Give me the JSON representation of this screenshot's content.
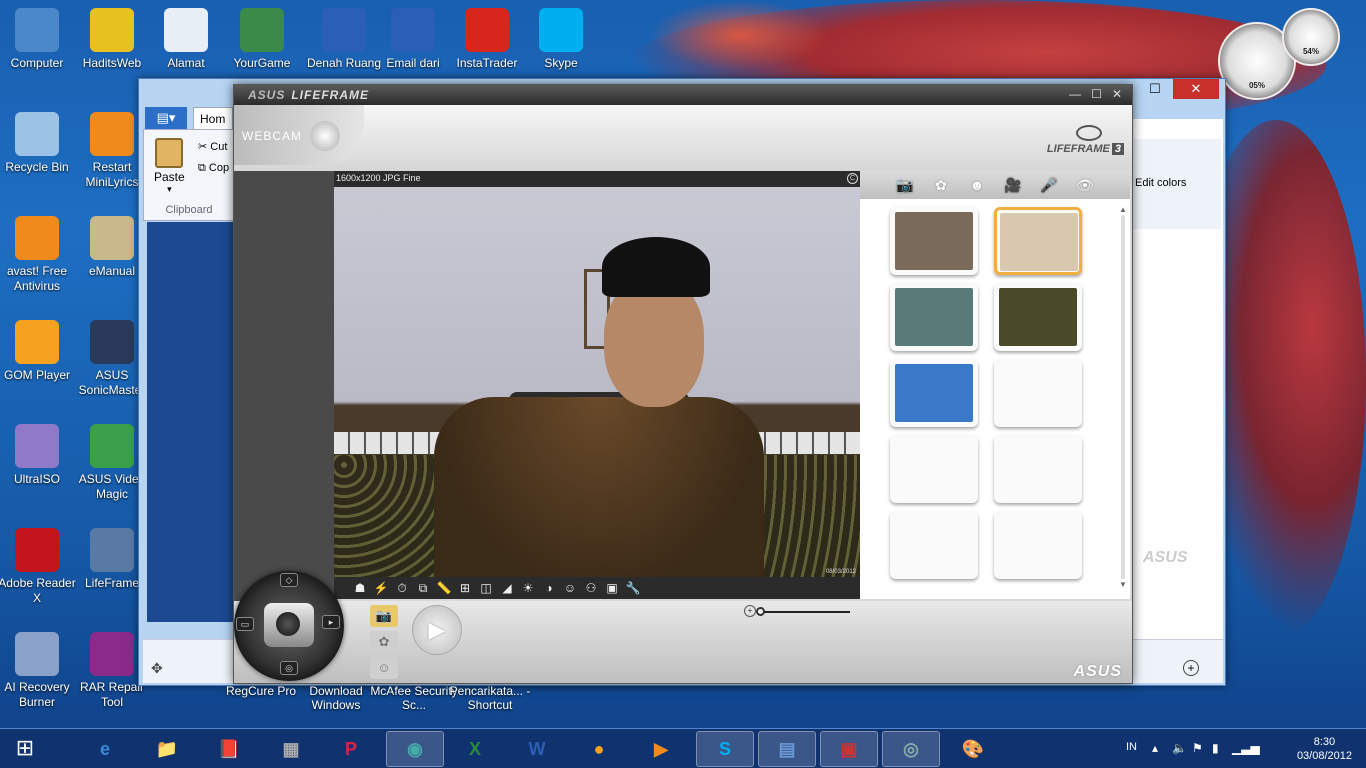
{
  "desktop": {
    "icons_row1": [
      {
        "label": "Computer",
        "icon": "computer-icon",
        "color": "#4a88c9"
      },
      {
        "label": "HaditsWeb",
        "icon": "help-document-icon",
        "color": "#e6c120"
      },
      {
        "label": "Alamat",
        "icon": "text-file-icon",
        "color": "#e8eef6"
      },
      {
        "label": "YourGame",
        "icon": "window-app-icon",
        "color": "#3a8a4a"
      },
      {
        "label": "Denah Ruang",
        "icon": "word-document-icon",
        "color": "#2b5fb5"
      },
      {
        "label": "Email dari",
        "icon": "word-document-icon",
        "color": "#2b5fb5"
      },
      {
        "label": "InstaTrader",
        "icon": "instatrader-icon",
        "color": "#d9261c"
      },
      {
        "label": "Skype",
        "icon": "skype-icon",
        "color": "#00aff0"
      }
    ],
    "icons_col1": [
      {
        "label": "Recycle Bin",
        "icon": "recycle-bin-icon",
        "color": "#9cc3e6"
      },
      {
        "label": "avast! Free Antivirus",
        "icon": "avast-icon",
        "color": "#f08a1c"
      },
      {
        "label": "GOM Player",
        "icon": "gom-player-icon",
        "color": "#f5a21e"
      },
      {
        "label": "UltraISO",
        "icon": "disc-icon",
        "color": "#8e7ac9"
      },
      {
        "label": "Adobe Reader X",
        "icon": "adobe-reader-icon",
        "color": "#c4151c"
      },
      {
        "label": "AI Recovery Burner",
        "icon": "disc-burner-icon",
        "color": "#8aa2c9"
      }
    ],
    "icons_col2": [
      {
        "label": "Restart MiniLyrics",
        "icon": "music-note-icon",
        "color": "#f08a1c"
      },
      {
        "label": "eManual",
        "icon": "manual-icon",
        "color": "#c9b98a"
      },
      {
        "label": "ASUS SonicMaster",
        "icon": "sonicmaster-icon",
        "color": "#2a3a5a"
      },
      {
        "label": "ASUS Video Magic",
        "icon": "video-magic-icon",
        "color": "#3aa04a"
      },
      {
        "label": "LifeFrame",
        "icon": "lifeframe-icon",
        "color": "#5a7aa6"
      },
      {
        "label": "RAR Repair Tool",
        "icon": "rar-icon",
        "color": "#8a2a8a"
      }
    ],
    "icons_col3": [
      {
        "label": "ASUS SonicMaster",
        "icon": "sonicmaster-icon",
        "color": "#2a3a5a"
      },
      {
        "label": "ASUS Video Magic",
        "icon": "video-magic-icon",
        "color": "#3aa04a"
      },
      {
        "label": "LifeFrame",
        "icon": "lifeframe-icon",
        "color": "#5a7aa6"
      },
      {
        "label": "RAR Repair Tool",
        "icon": "rar-icon",
        "color": "#8a2a8a"
      }
    ],
    "partial_labels": [
      "RegCure Pro",
      "Download Windows",
      "McAfee Security Sc...",
      "Pencarikata... - Shortcut"
    ],
    "gadget": {
      "cpu": "05%",
      "ram": "54%"
    }
  },
  "explorer": {
    "ribbon": {
      "home_tab": "Hom",
      "paste": "Paste",
      "cut": "Cut",
      "copy": "Cop",
      "group": "Clipboard"
    },
    "edit_colors": "Edit colors",
    "watermark": "ASUS"
  },
  "lifeframe": {
    "brand": "ASUS",
    "title": "LIFEFRAME",
    "webcam_label": "WEBCAM",
    "logo": "LIFEFRAME",
    "logo_version": "3",
    "resolution": "1600x1200 JPG Fine",
    "preview_watermark": "08/03/2012",
    "tabs": [
      {
        "name": "camera-tab",
        "icon": "📷"
      },
      {
        "name": "effects-tab",
        "icon": "✿"
      },
      {
        "name": "face-tab",
        "icon": "☻"
      },
      {
        "name": "video-tab",
        "icon": "🎥"
      },
      {
        "name": "mic-tab",
        "icon": "🎤"
      },
      {
        "name": "view-tab",
        "icon": "👁"
      }
    ],
    "thumbnails": [
      {
        "color": "#7a6a5a",
        "selected": false
      },
      {
        "color": "#d8c8b0",
        "selected": true
      },
      {
        "color": "#5a7a7a",
        "selected": false
      },
      {
        "color": "#4a4a2a",
        "selected": false
      },
      {
        "color": "#3a78c8",
        "selected": false
      },
      {
        "color": "#fafafa",
        "selected": false
      },
      {
        "color": "#fafafa",
        "selected": false
      },
      {
        "color": "#fafafa",
        "selected": false
      },
      {
        "color": "#fafafa",
        "selected": false
      },
      {
        "color": "#fafafa",
        "selected": false
      }
    ],
    "toolbar": [
      "☗",
      "⚡",
      "⏱",
      "⧉",
      "📏",
      "⊞",
      "◫",
      "◢",
      "☀",
      "◑",
      "☺",
      "⚇",
      "▣",
      "🔧"
    ],
    "zoom_level": 0,
    "asus_footer": "ASUS"
  },
  "taskbar": {
    "apps": [
      {
        "name": "internet-explorer",
        "icon": "e",
        "color": "#3a8ad6",
        "open": false
      },
      {
        "name": "file-explorer",
        "icon": "📁",
        "color": "#e6c060",
        "open": false
      },
      {
        "name": "book-app",
        "icon": "📕",
        "color": "#c33",
        "open": false
      },
      {
        "name": "calculator",
        "icon": "▦",
        "color": "#aaa",
        "open": false
      },
      {
        "name": "powerpoint",
        "icon": "P",
        "color": "#d24",
        "open": false
      },
      {
        "name": "network-app",
        "icon": "◉",
        "color": "#4aa",
        "open": true
      },
      {
        "name": "excel",
        "icon": "X",
        "color": "#2a8a3a",
        "open": false
      },
      {
        "name": "word",
        "icon": "W",
        "color": "#2b5fb5",
        "open": false
      },
      {
        "name": "gom-player",
        "icon": "●",
        "color": "#f5a21e",
        "open": false
      },
      {
        "name": "media-player",
        "icon": "▶",
        "color": "#f08a1c",
        "open": false
      },
      {
        "name": "skype",
        "icon": "S",
        "color": "#00aff0",
        "open": true
      },
      {
        "name": "control-panel",
        "icon": "▤",
        "color": "#6a9ad6",
        "open": true
      },
      {
        "name": "toolbox",
        "icon": "▣",
        "color": "#c33",
        "open": true
      },
      {
        "name": "lifeframe",
        "icon": "◎",
        "color": "#8aa",
        "open": true
      },
      {
        "name": "paint",
        "icon": "🎨",
        "color": "#e6b040",
        "open": false
      }
    ],
    "language": "IN",
    "time": "8:30",
    "date": "03/08/2012"
  }
}
